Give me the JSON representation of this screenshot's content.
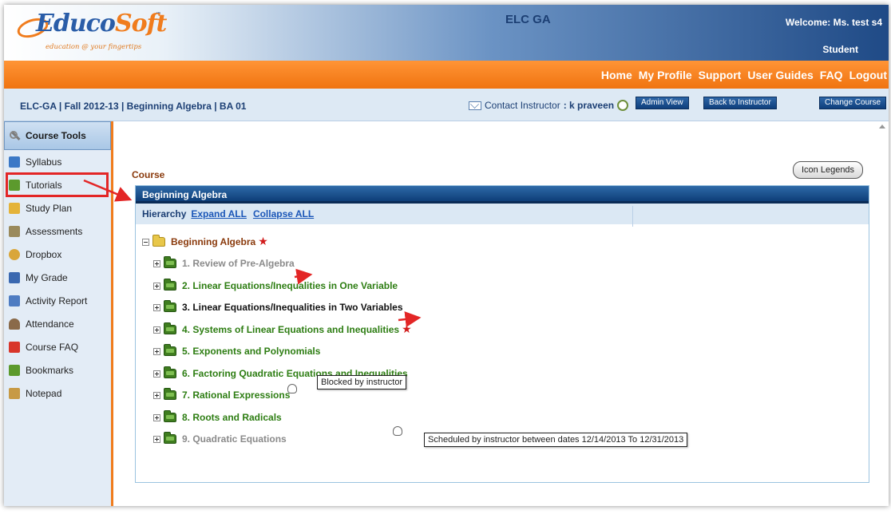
{
  "header": {
    "logo_text_main": "Educo",
    "logo_text_accent": "Soft",
    "logo_tm": "™",
    "tagline": "education @ your fingertips",
    "course_title": "ELC GA",
    "welcome": "Welcome: Ms. test s4",
    "role": "Student"
  },
  "topnav": {
    "items": [
      "Home",
      "My Profile",
      "Support",
      "User Guides",
      "FAQ",
      "Logout"
    ]
  },
  "crumbbar": {
    "breadcrumb": "ELC-GA | Fall 2012-13 | Beginning Algebra | BA 01",
    "contact_label": "Contact Instructor",
    "instructor": ": k praveen",
    "admin_view": "Admin View",
    "back_to_instructor": "Back to Instructor",
    "change_course": "Change Course"
  },
  "sidebar": {
    "header": "Course Tools",
    "items": [
      {
        "label": "Syllabus",
        "icon": "syllabus-icon",
        "color": "#3b78c6"
      },
      {
        "label": "Tutorials",
        "icon": "tutorials-icon",
        "color": "#5c9a2d"
      },
      {
        "label": "Study Plan",
        "icon": "study-plan-icon",
        "color": "#e4b33a"
      },
      {
        "label": "Assessments",
        "icon": "assessments-icon",
        "color": "#9a8a5c"
      },
      {
        "label": "Dropbox",
        "icon": "dropbox-icon",
        "color": "#d9a63a"
      },
      {
        "label": "My Grade",
        "icon": "grade-icon",
        "color": "#3a68b0"
      },
      {
        "label": "Activity Report",
        "icon": "activity-report-icon",
        "color": "#4e7cc2"
      },
      {
        "label": "Attendance",
        "icon": "attendance-icon",
        "color": "#8a6a4a"
      },
      {
        "label": "Course FAQ",
        "icon": "course-faq-icon",
        "color": "#d8362a"
      },
      {
        "label": "Bookmarks",
        "icon": "bookmarks-icon",
        "color": "#5c9a2d"
      },
      {
        "label": "Notepad",
        "icon": "notepad-icon",
        "color": "#c79a45"
      }
    ]
  },
  "main": {
    "section_title": "Course",
    "icon_legends": "Icon Legends",
    "panel_title": "Beginning Algebra",
    "hierarchy_label": "Hierarchy",
    "expand_all": "Expand ALL",
    "collapse_all": "Collapse ALL",
    "root": "Beginning Algebra",
    "topics": [
      {
        "label": "1. Review of Pre-Algebra",
        "status": "grey"
      },
      {
        "label": "2. Linear Equations/Inequalities in One Variable",
        "status": "green"
      },
      {
        "label": "3. Linear Equations/Inequalities in Two Variables",
        "status": "black"
      },
      {
        "label": "4. Systems of Linear Equations and Inequalities",
        "status": "green"
      },
      {
        "label": "5. Exponents and Polynomials",
        "status": "green"
      },
      {
        "label": "6. Factoring Quadratic Equations and Inequalities",
        "status": "green"
      },
      {
        "label": "7. Rational Expressions",
        "status": "green"
      },
      {
        "label": "8. Roots and Radicals",
        "status": "green"
      },
      {
        "label": "9. Quadratic Equations",
        "status": "grey"
      }
    ],
    "tooltip_blocked": "Blocked by instructor",
    "tooltip_scheduled": "Scheduled by instructor between dates 12/14/2013  To 12/31/2013"
  },
  "colors": {
    "accent_orange": "#f07c1d",
    "header_blue": "#1f4a86",
    "annotation_red": "#e32626"
  }
}
